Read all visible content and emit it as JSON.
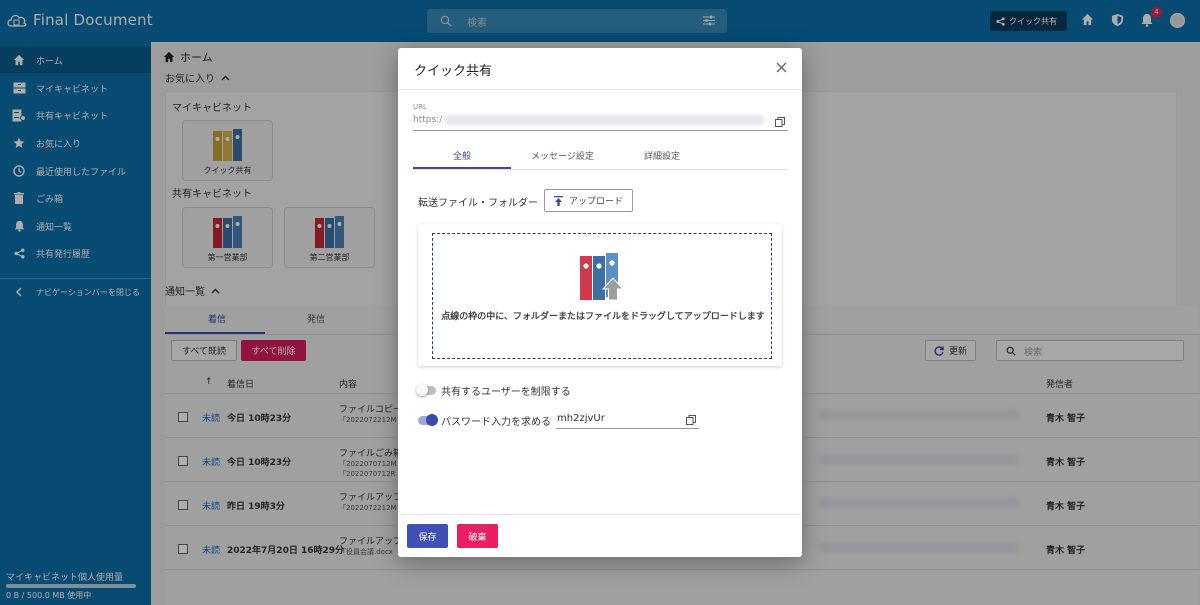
{
  "app": {
    "name": "Final Document"
  },
  "header": {
    "search_placeholder": "検索",
    "quick_share_label": "クイック共有",
    "notification_count": "4"
  },
  "sidebar": {
    "items": [
      {
        "label": "ホーム",
        "icon": "home-icon"
      },
      {
        "label": "マイキャビネット",
        "icon": "cabinet-icon"
      },
      {
        "label": "共有キャビネット",
        "icon": "shared-cabinet-icon"
      },
      {
        "label": "お気に入り",
        "icon": "star-icon"
      },
      {
        "label": "最近使用したファイル",
        "icon": "clock-icon"
      },
      {
        "label": "ごみ箱",
        "icon": "trash-icon"
      },
      {
        "label": "通知一覧",
        "icon": "bell-icon"
      },
      {
        "label": "共有発行履歴",
        "icon": "share-icon"
      }
    ],
    "collapse_label": "ナビゲーションバーを閉じる",
    "usage_label": "マイキャビネット個人使用量",
    "usage_text": "0 B / 500.0 MB 使用中",
    "usage_fraction": 0.0
  },
  "main": {
    "breadcrumb": "ホーム",
    "favorites_title": "お気に入り",
    "my_cabinet_label": "マイキャビネット",
    "shared_cabinet_label": "共有キャビネット",
    "my_cabinets": [
      {
        "name": "クイック共有"
      }
    ],
    "shared_cabinets": [
      {
        "name": "第一営業部"
      },
      {
        "name": "第二営業部"
      }
    ],
    "notifications_title": "通知一覧",
    "tabs": [
      {
        "label": "着信"
      },
      {
        "label": "発信"
      }
    ],
    "mark_all_read": "すべて既読",
    "delete_all": "すべて削除",
    "refresh": "更新",
    "filter_placeholder": "検索",
    "columns": {
      "sort_arrow": "↑",
      "received": "着信日",
      "content": "内容",
      "sender": "発信者"
    },
    "rows": [
      {
        "status": "未読",
        "date": "今日 10時23分",
        "line1": "ファイルコピー",
        "line2": "「2022072212M",
        "line3": "",
        "sender": "青木 智子"
      },
      {
        "status": "未読",
        "date": "今日 10時23分",
        "line1": "ファイルごみ箱",
        "line2": "「2022070712M",
        "line3": "「2022070712R",
        "sender": "青木 智子"
      },
      {
        "status": "未読",
        "date": "昨日 19時3分",
        "line1": "ファイルアップ",
        "line2": "「2022072212M",
        "line3": "",
        "sender": "青木 智子"
      },
      {
        "status": "未読",
        "date": "2022年7月20日 16時29分",
        "line1": "ファイルアップ",
        "line2": "「役員会議.docx",
        "line3": "",
        "sender": "青木 智子"
      }
    ]
  },
  "modal": {
    "title": "クイック共有",
    "url_label": "URL",
    "url_value": "https:/",
    "tabs": [
      {
        "label": "全般"
      },
      {
        "label": "メッセージ設定"
      },
      {
        "label": "詳細設定"
      }
    ],
    "transfer_label": "転送ファイル・フォルダー",
    "upload_label": "アップロード",
    "drop_text": "点線の枠の中に、フォルダーまたはファイルをドラッグしてアップロードします",
    "restrict_users_label": "共有するユーザーを制限する",
    "restrict_users_on": false,
    "password_label": "パスワード入力を求める",
    "password_on": true,
    "password_value": "mh2zjvUr",
    "save_label": "保存",
    "discard_label": "破棄"
  },
  "colors": {
    "brand": "#0b6fa8",
    "accent": "#3949ab",
    "danger": "#e91e63"
  }
}
